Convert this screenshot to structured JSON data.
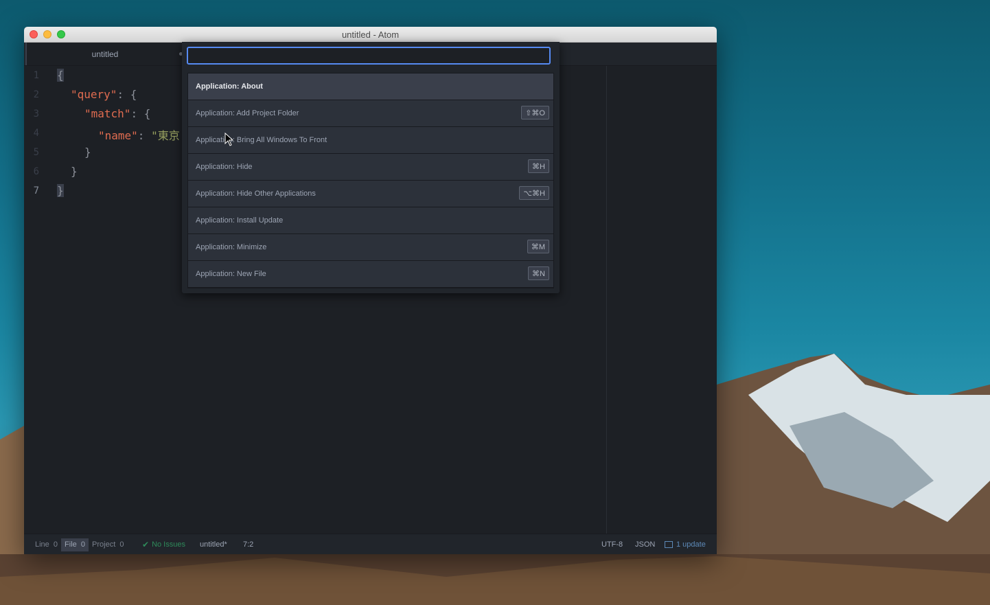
{
  "window": {
    "title": "untitled - Atom"
  },
  "tab": {
    "title": "untitled"
  },
  "editor": {
    "line_numbers": [
      "1",
      "2",
      "3",
      "4",
      "5",
      "6",
      "7"
    ],
    "lines": [
      [
        "{"
      ],
      [
        "\"query\"",
        ": {"
      ],
      [
        "\"match\"",
        ": {"
      ],
      [
        "\"name\"",
        ": ",
        "\"東京"
      ],
      [
        "}"
      ],
      [
        "}"
      ],
      [
        "}"
      ]
    ]
  },
  "command_palette": {
    "query": "",
    "items": [
      {
        "label": "Application: About",
        "shortcut": ""
      },
      {
        "label": "Application: Add Project Folder",
        "shortcut": "⇧⌘O"
      },
      {
        "label": "Application: Bring All Windows To Front",
        "shortcut": ""
      },
      {
        "label": "Application: Hide",
        "shortcut": "⌘H"
      },
      {
        "label": "Application: Hide Other Applications",
        "shortcut": "⌥⌘H"
      },
      {
        "label": "Application: Install Update",
        "shortcut": ""
      },
      {
        "label": "Application: Minimize",
        "shortcut": "⌘M"
      },
      {
        "label": "Application: New File",
        "shortcut": "⌘N"
      }
    ]
  },
  "status_bar": {
    "line": "Line",
    "line_count": "0",
    "file": "File",
    "file_count": "0",
    "project": "Project",
    "project_count": "0",
    "lint_status": "No Issues",
    "file_name": "untitled*",
    "cursor_pos": "7:2",
    "encoding": "UTF-8",
    "grammar": "JSON",
    "updates": "1 update"
  },
  "colors": {
    "accent": "#568af2",
    "string": "#97a05f",
    "key": "#e06c50",
    "ok_green": "#2e8a5a"
  }
}
